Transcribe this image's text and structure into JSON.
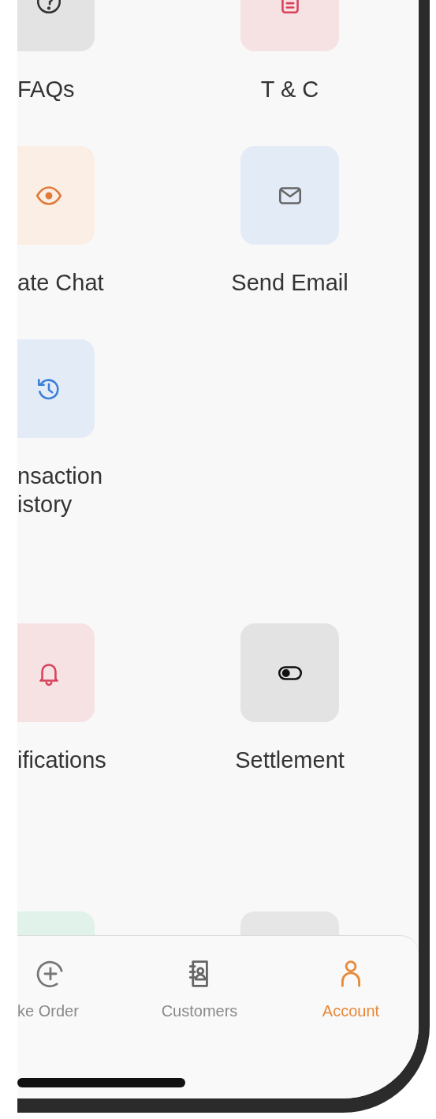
{
  "sections": [
    {
      "items": [
        {
          "label": "FAQs",
          "kind": "help",
          "color": "#e3e3e3"
        },
        {
          "label": "T & C",
          "kind": "document",
          "color": "#f6e1e3"
        },
        {
          "label": "ate Chat",
          "kind": "eye",
          "color": "#fbeee4"
        },
        {
          "label": "Send Email",
          "kind": "mail",
          "color": "#e3ebf7"
        },
        {
          "label": "nsaction\nistory",
          "kind": "history",
          "color": "#e3ebf7"
        }
      ]
    },
    {
      "items": [
        {
          "label": "ifications",
          "kind": "bell",
          "color": "#f6e1e3"
        },
        {
          "label": "Settlement",
          "kind": "toggle",
          "color": "#e3e3e3"
        }
      ]
    },
    {
      "items": [
        {
          "kind": "none",
          "color": "#e0f2ea"
        },
        {
          "kind": "none",
          "color": "#e6e6e6"
        }
      ]
    }
  ],
  "tabs": [
    {
      "label": "ke Order",
      "kind": "plus",
      "selected": false
    },
    {
      "label": "Customers",
      "kind": "contacts",
      "selected": false
    },
    {
      "label": "Account",
      "kind": "person",
      "selected": true
    }
  ]
}
